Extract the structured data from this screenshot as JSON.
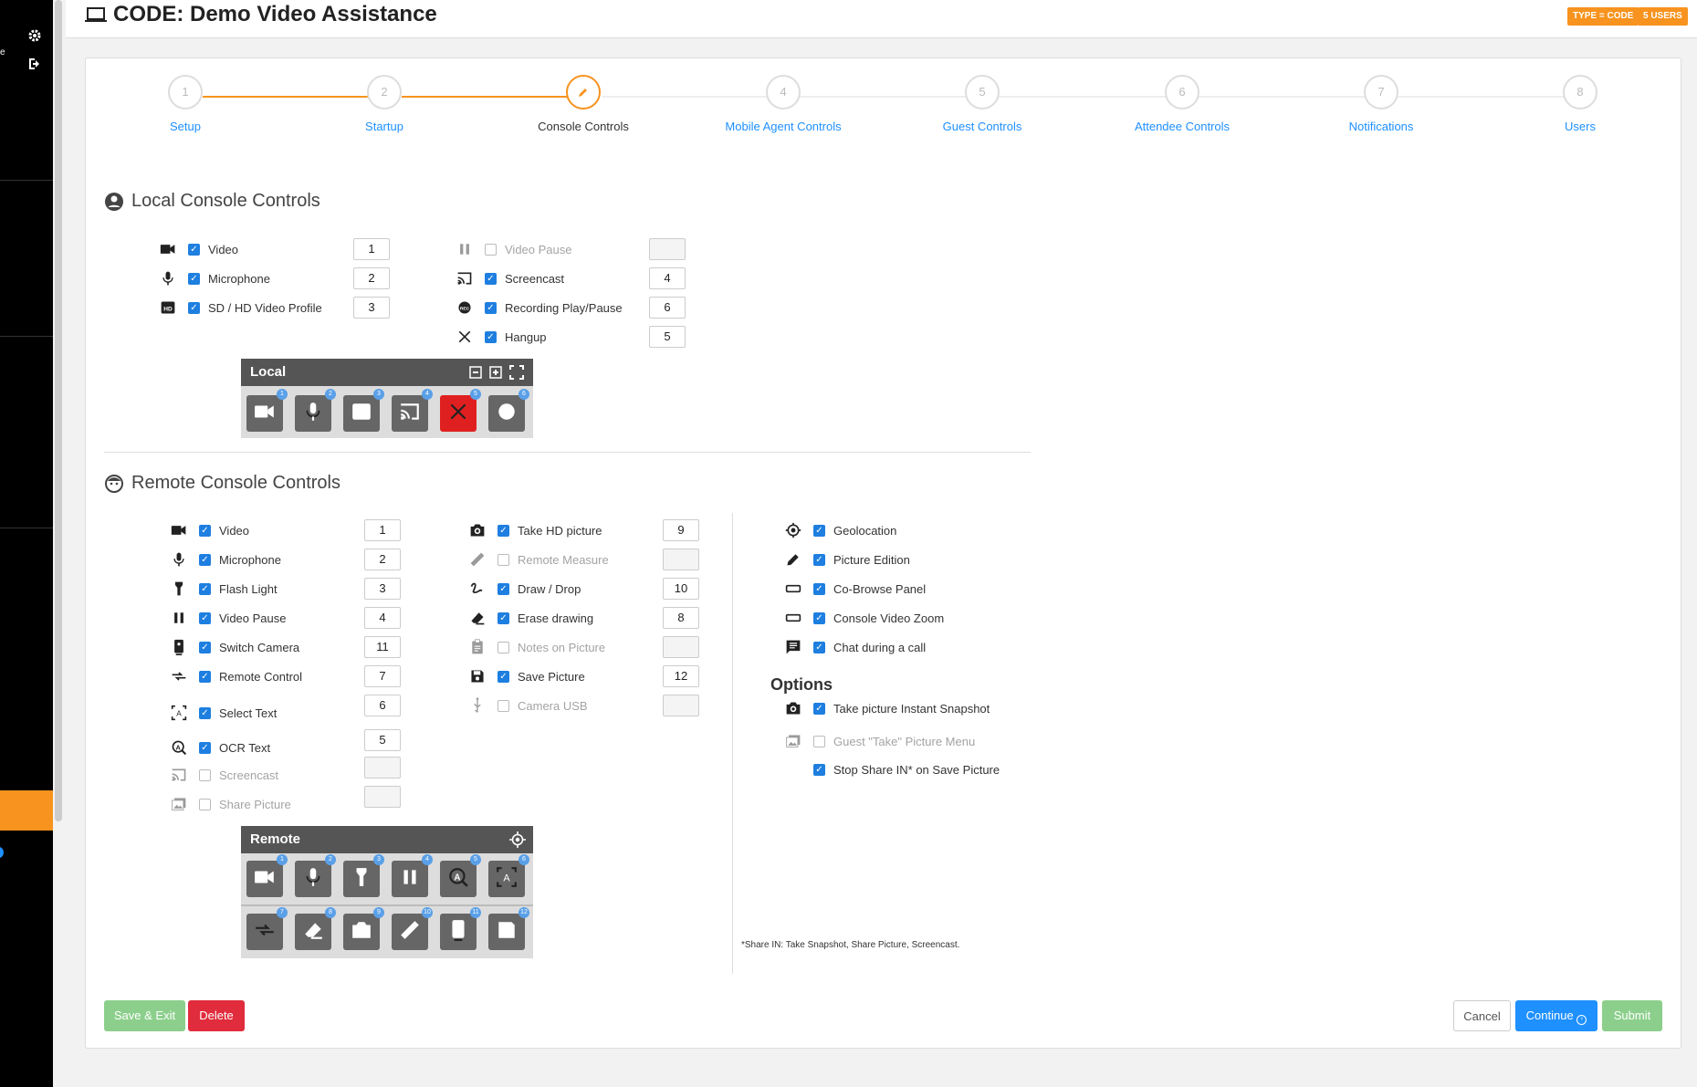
{
  "header": {
    "title": "CODE: Demo Video Assistance",
    "badges": [
      "TYPE = CODE",
      "5 USERS"
    ]
  },
  "sidebar": {
    "mini_text": "e"
  },
  "steps": [
    {
      "num": "1",
      "label": "Setup"
    },
    {
      "num": "2",
      "label": "Startup"
    },
    {
      "num": "",
      "label": "Console Controls"
    },
    {
      "num": "4",
      "label": "Mobile Agent Controls"
    },
    {
      "num": "5",
      "label": "Guest Controls"
    },
    {
      "num": "6",
      "label": "Attendee Controls"
    },
    {
      "num": "7",
      "label": "Notifications"
    },
    {
      "num": "8",
      "label": "Users"
    }
  ],
  "local": {
    "title": "Local Console Controls",
    "left": [
      {
        "label": "Video",
        "checked": true,
        "value": "1",
        "icon": "videocam-icon"
      },
      {
        "label": "Microphone",
        "checked": true,
        "value": "2",
        "icon": "microphone-icon"
      },
      {
        "label": "SD / HD Video Profile",
        "checked": true,
        "value": "3",
        "icon": "hd-icon"
      }
    ],
    "right": [
      {
        "label": "Video Pause",
        "checked": false,
        "value": "",
        "icon": "pause-icon"
      },
      {
        "label": "Screencast",
        "checked": true,
        "value": "4",
        "icon": "cast-icon"
      },
      {
        "label": "Recording Play/Pause",
        "checked": true,
        "value": "6",
        "icon": "rec-icon"
      },
      {
        "label": "Hangup",
        "checked": true,
        "value": "5",
        "icon": "close-icon"
      }
    ],
    "panel_title": "Local",
    "panel_buttons": [
      "1",
      "2",
      "3",
      "4",
      "5",
      "6"
    ]
  },
  "remote": {
    "title": "Remote Console Controls",
    "col1": [
      {
        "label": "Video",
        "checked": true,
        "value": "1",
        "icon": "videocam-icon"
      },
      {
        "label": "Microphone",
        "checked": true,
        "value": "2",
        "icon": "microphone-icon"
      },
      {
        "label": "Flash Light",
        "checked": true,
        "value": "3",
        "icon": "flashlight-icon"
      },
      {
        "label": "Video Pause",
        "checked": true,
        "value": "4",
        "icon": "pause-icon"
      },
      {
        "label": "Switch Camera",
        "checked": true,
        "value": "11",
        "icon": "switch-camera-icon"
      },
      {
        "label": "Remote Control",
        "checked": true,
        "value": "7",
        "icon": "remote-control-icon"
      },
      {
        "label": "Select Text",
        "checked": true,
        "value": "6",
        "icon": "select-text-icon"
      },
      {
        "label": "OCR Text",
        "checked": true,
        "value": "5",
        "icon": "ocr-icon"
      },
      {
        "label": "Screencast",
        "checked": false,
        "value": "",
        "icon": "cast-icon"
      },
      {
        "label": "Share Picture",
        "checked": false,
        "value": "",
        "icon": "share-picture-icon"
      }
    ],
    "col2": [
      {
        "label": "Take HD picture",
        "checked": true,
        "value": "9",
        "icon": "camera-icon"
      },
      {
        "label": "Remote Measure",
        "checked": false,
        "value": "",
        "icon": "ruler-icon"
      },
      {
        "label": "Draw / Drop",
        "checked": true,
        "value": "10",
        "icon": "draw-icon"
      },
      {
        "label": "Erase drawing",
        "checked": true,
        "value": "8",
        "icon": "eraser-icon"
      },
      {
        "label": "Notes on Picture",
        "checked": false,
        "value": "",
        "icon": "notes-icon"
      },
      {
        "label": "Save Picture",
        "checked": true,
        "value": "12",
        "icon": "save-icon"
      },
      {
        "label": "Camera USB",
        "checked": false,
        "value": "",
        "icon": "usb-icon"
      }
    ],
    "col3": [
      {
        "label": "Geolocation",
        "checked": true,
        "icon": "geolocation-icon"
      },
      {
        "label": "Picture Edition",
        "checked": true,
        "icon": "pencil-icon"
      },
      {
        "label": "Co-Browse Panel",
        "checked": true,
        "icon": "panel-icon"
      },
      {
        "label": "Console Video Zoom",
        "checked": true,
        "icon": "zoom-panel-icon"
      },
      {
        "label": "Chat during a call",
        "checked": true,
        "icon": "chat-icon"
      }
    ],
    "options_title": "Options",
    "options": [
      {
        "label": "Take picture Instant Snapshot",
        "checked": true,
        "icon": "camera-icon"
      },
      {
        "label": "Guest \"Take\" Picture Menu",
        "checked": false,
        "icon": "gallery-icon"
      },
      {
        "label": "Stop Share IN* on Save Picture",
        "checked": true,
        "icon": ""
      }
    ],
    "panel_title": "Remote",
    "panel_row1": [
      "1",
      "2",
      "3",
      "4",
      "5",
      "6"
    ],
    "panel_row2": [
      "7",
      "8",
      "9",
      "10",
      "11",
      "12"
    ],
    "footnote": "*Share IN: Take Snapshot, Share Picture, Screencast."
  },
  "footer": {
    "save_exit": "Save & Exit",
    "delete": "Delete",
    "cancel": "Cancel",
    "continue": "Continue",
    "submit": "Submit"
  },
  "colors": {
    "accent": "#f7931e",
    "primary": "#1e90ff",
    "danger": "#e02020",
    "success": "#8ccf8c"
  }
}
